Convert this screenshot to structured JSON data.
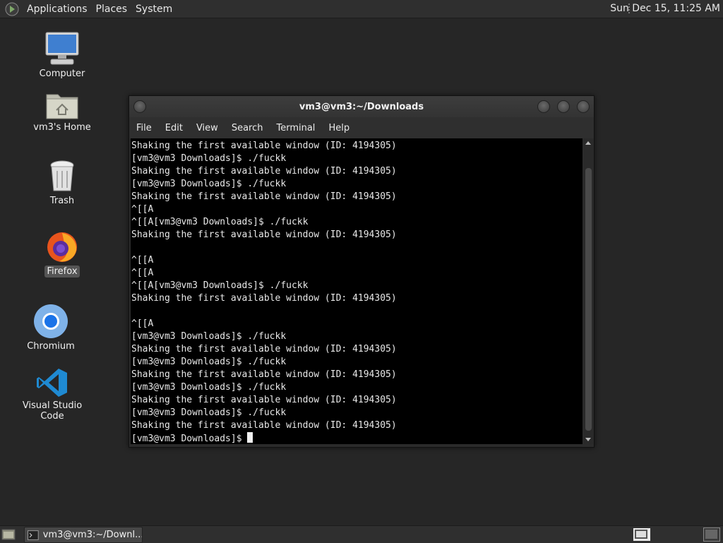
{
  "top_panel": {
    "menus": [
      "Applications",
      "Places",
      "System"
    ],
    "clock": "Sun Dec 15, 11:25 AM"
  },
  "desktop": {
    "icons": [
      {
        "label": "Computer",
        "icon": "computer-icon"
      },
      {
        "label": "vm3's Home",
        "icon": "home-folder-icon"
      },
      {
        "label": "Trash",
        "icon": "trash-icon"
      },
      {
        "label": "Firefox",
        "icon": "firefox-icon",
        "selected": true
      },
      {
        "label": "Chromium",
        "icon": "chromium-icon"
      },
      {
        "label": "Visual Studio Code",
        "icon": "vscode-icon"
      }
    ]
  },
  "terminal": {
    "title": "vm3@vm3:~/Downloads",
    "menu": [
      "File",
      "Edit",
      "View",
      "Search",
      "Terminal",
      "Help"
    ],
    "lines": [
      "Shaking the first available window (ID: 4194305)",
      "[vm3@vm3 Downloads]$ ./fuckk",
      "Shaking the first available window (ID: 4194305)",
      "[vm3@vm3 Downloads]$ ./fuckk",
      "Shaking the first available window (ID: 4194305)",
      "^[[A",
      "^[[A[vm3@vm3 Downloads]$ ./fuckk",
      "Shaking the first available window (ID: 4194305)",
      "",
      "^[[A",
      "^[[A",
      "^[[A[vm3@vm3 Downloads]$ ./fuckk",
      "Shaking the first available window (ID: 4194305)",
      "",
      "^[[A",
      "[vm3@vm3 Downloads]$ ./fuckk",
      "Shaking the first available window (ID: 4194305)",
      "[vm3@vm3 Downloads]$ ./fuckk",
      "Shaking the first available window (ID: 4194305)",
      "[vm3@vm3 Downloads]$ ./fuckk",
      "Shaking the first available window (ID: 4194305)",
      "[vm3@vm3 Downloads]$ ./fuckk",
      "Shaking the first available window (ID: 4194305)"
    ],
    "prompt": "[vm3@vm3 Downloads]$ "
  },
  "bottom_panel": {
    "task_label": "vm3@vm3:~/Downl..."
  },
  "colors": {
    "desktop_bg": "#262626",
    "panel_bg": "#2f2f2f",
    "terminal_bg": "#000000"
  }
}
